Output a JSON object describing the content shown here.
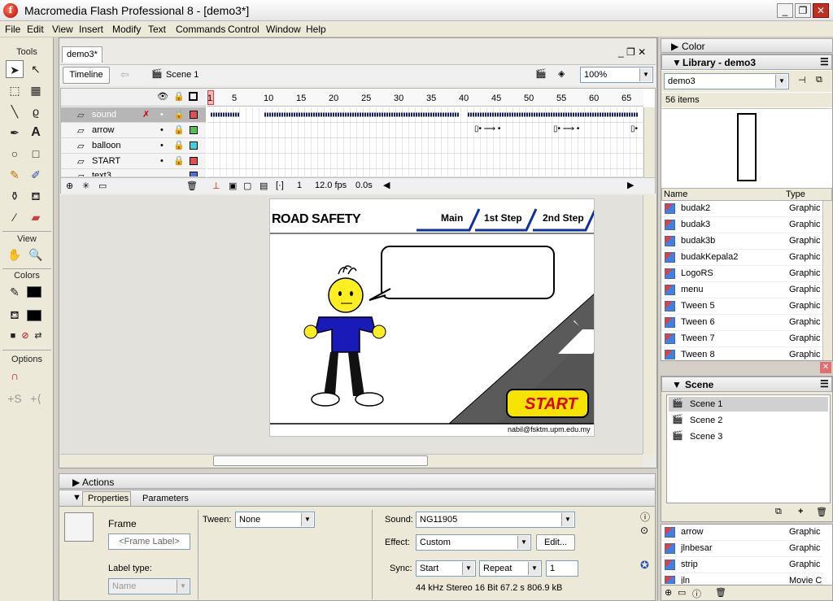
{
  "window": {
    "title": "Macromedia Flash Professional 8 - [demo3*]",
    "minimize_glyph": "_",
    "restore_glyph": "❐",
    "close_glyph": "✕"
  },
  "menu": [
    "File",
    "Edit",
    "View",
    "Insert",
    "Modify",
    "Text",
    "Commands",
    "Control",
    "Window",
    "Help"
  ],
  "tools": {
    "header": "Tools",
    "view_header": "View",
    "colors_header": "Colors",
    "options_header": "Options"
  },
  "document": {
    "tab": "demo3*",
    "timeline_button": "Timeline",
    "scene_label": "Scene 1",
    "zoom": "100%"
  },
  "timeline": {
    "ruler": [
      "1",
      "5",
      "10",
      "15",
      "20",
      "25",
      "30",
      "35",
      "40",
      "45",
      "50",
      "55",
      "60",
      "65"
    ],
    "layers": [
      {
        "name": "sound",
        "color": "#e05050"
      },
      {
        "name": "arrow",
        "color": "#50c050"
      },
      {
        "name": "balloon",
        "color": "#40d0e0"
      },
      {
        "name": "START",
        "color": "#e05050"
      },
      {
        "name": "text3",
        "color": "#5070e0"
      }
    ],
    "frame": "1",
    "fps": "12.0 fps",
    "time": "0.0s"
  },
  "stage": {
    "title": "ROAD SAFETY",
    "nav": [
      "Main",
      "1st Step",
      "2nd Step"
    ],
    "start": "START",
    "email": "nabil@fsktm.upm.edu.my"
  },
  "actions_panel": {
    "label": "Actions"
  },
  "properties": {
    "tab_properties": "Properties",
    "tab_parameters": "Parameters",
    "frame_label": "Frame",
    "frame_placeholder": "<Frame Label>",
    "label_type": "Label type:",
    "label_type_value": "Name",
    "tween_label": "Tween:",
    "tween_value": "None",
    "sound_label": "Sound:",
    "sound_value": "NG11905",
    "effect_label": "Effect:",
    "effect_value": "Custom",
    "edit_button": "Edit...",
    "sync_label": "Sync:",
    "sync_value": "Start",
    "repeat_value": "Repeat",
    "repeat_count": "1",
    "sound_info": "44 kHz Stereo 16 Bit 67.2 s 806.9 kB"
  },
  "color_panel": {
    "label": "Color"
  },
  "library": {
    "title": "Library - demo3",
    "selector": "demo3",
    "count": "56 items",
    "col_name": "Name",
    "col_type": "Type",
    "items": [
      {
        "name": "budak2",
        "type": "Graphic"
      },
      {
        "name": "budak3",
        "type": "Graphic"
      },
      {
        "name": "budak3b",
        "type": "Graphic"
      },
      {
        "name": "budakKepala2",
        "type": "Graphic"
      },
      {
        "name": "LogoRS",
        "type": "Graphic"
      },
      {
        "name": "menu",
        "type": "Graphic"
      },
      {
        "name": "Tween 5",
        "type": "Graphic"
      },
      {
        "name": "Tween 6",
        "type": "Graphic"
      },
      {
        "name": "Tween 7",
        "type": "Graphic"
      },
      {
        "name": "Tween 8",
        "type": "Graphic"
      }
    ],
    "items2": [
      {
        "name": "arrow",
        "type": "Graphic"
      },
      {
        "name": "jlnbesar",
        "type": "Graphic"
      },
      {
        "name": "strip",
        "type": "Graphic"
      },
      {
        "name": "jln",
        "type": "Movie C"
      }
    ]
  },
  "scene_panel": {
    "title": "Scene",
    "scenes": [
      "Scene 1",
      "Scene 2",
      "Scene 3"
    ]
  }
}
